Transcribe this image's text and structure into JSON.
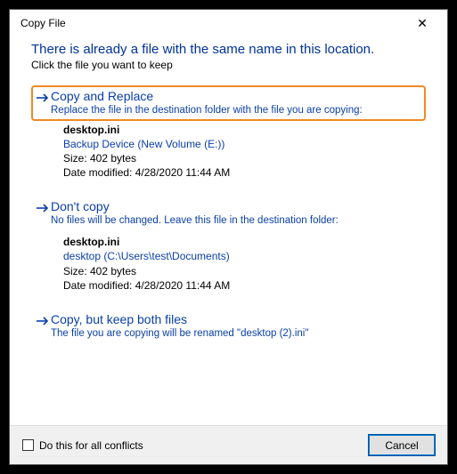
{
  "window": {
    "title": "Copy File",
    "close_glyph": "✕"
  },
  "main": {
    "heading": "There is already a file with the same name in this location.",
    "subheading": "Click the file you want to keep"
  },
  "options": [
    {
      "title": "Copy and Replace",
      "desc": "Replace the file in the destination folder with the file you are copying:",
      "file": {
        "name": "desktop.ini",
        "path": "Backup Device (New Volume (E:))",
        "size": "Size: 402 bytes",
        "modified": "Date modified: 4/28/2020 11:44 AM"
      }
    },
    {
      "title": "Don't copy",
      "desc": "No files will be changed. Leave this file in the destination folder:",
      "file": {
        "name": "desktop.ini",
        "path": "desktop (C:\\Users\\test\\Documents)",
        "size": "Size: 402 bytes",
        "modified": "Date modified: 4/28/2020 11:44 AM"
      }
    },
    {
      "title": "Copy, but keep both files",
      "desc": "The file you are copying will be renamed \"desktop (2).ini\""
    }
  ],
  "footer": {
    "checkbox_label": "Do this for all conflicts",
    "cancel_label": "Cancel"
  }
}
